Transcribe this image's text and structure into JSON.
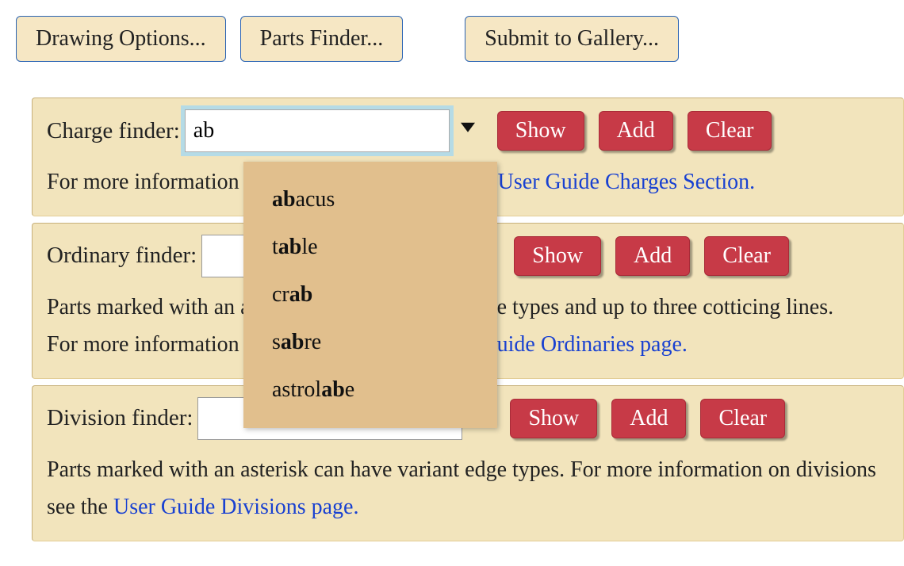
{
  "topButtons": {
    "drawing": "Drawing Options...",
    "parts": "Parts Finder...",
    "submit": "Submit to Gallery..."
  },
  "charge": {
    "label": "Charge finder:",
    "value": "ab",
    "show": "Show",
    "add": "Add",
    "clear": "Clear",
    "infoPrefix": "For more information on available charges see the ",
    "linkText": "User Guide Charges Section."
  },
  "autocomplete": {
    "items": [
      {
        "pre": "",
        "match": "ab",
        "post": "acus"
      },
      {
        "pre": "t",
        "match": "ab",
        "post": "le"
      },
      {
        "pre": "cr",
        "match": "ab",
        "post": ""
      },
      {
        "pre": "s",
        "match": "ab",
        "post": "re"
      },
      {
        "pre": "astrol",
        "match": "ab",
        "post": "e"
      }
    ]
  },
  "ordinary": {
    "label": "Ordinary finder:",
    "value": "",
    "show": "Show",
    "add": "Add",
    "clear": "Clear",
    "line1": "Parts marked with an asterisk can have variant edge types and up to three cotticing lines.",
    "line2pre": "For more information on ordinaries see the ",
    "linkText": "User Guide Ordinaries page."
  },
  "division": {
    "label": "Division finder:",
    "value": "",
    "show": "Show",
    "add": "Add",
    "clear": "Clear",
    "text1": "Parts marked with an asterisk can have variant edge types. For more information on divisions see the ",
    "linkText": "User Guide Divisions page."
  }
}
